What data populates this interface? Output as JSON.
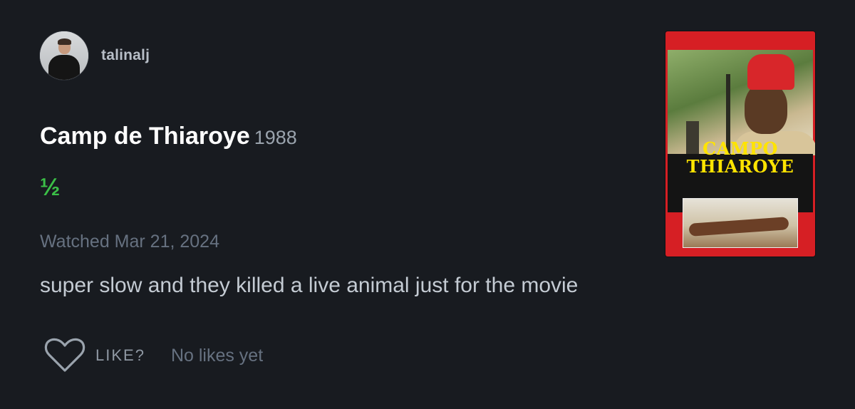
{
  "author": {
    "username": "talinalj"
  },
  "film": {
    "title": "Camp de Thiaroye",
    "year": "1988",
    "rating": "½",
    "poster": {
      "title_line1": "CAMPO",
      "title_line2": "THIAROYE"
    }
  },
  "review": {
    "watched": "Watched Mar 21, 2024",
    "text": "super slow and they killed a live animal just for the movie"
  },
  "actions": {
    "like_label": "LIKE?",
    "like_icon": "heart-outline",
    "likes_text": "No likes yet"
  },
  "colors": {
    "background": "#181b20",
    "rating_green": "#3bbf47",
    "title_white": "#ffffff",
    "muted_text": "#667180"
  }
}
